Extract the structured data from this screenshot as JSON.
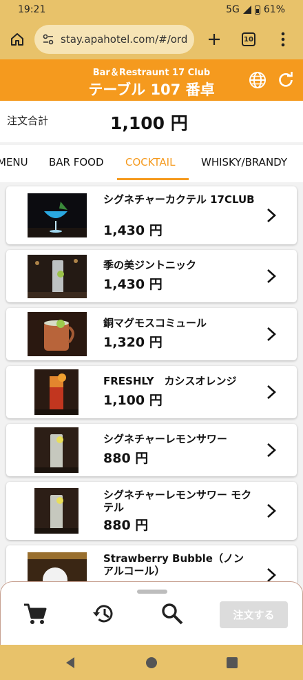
{
  "status": {
    "time": "19:21",
    "network": "5G",
    "battery": "61%"
  },
  "browser": {
    "url": "stay.apahotel.com/#/ord",
    "tab_count": "10"
  },
  "header": {
    "subtitle": "Bar＆Restraunt 17 Club",
    "title": "テーブル 107 番卓"
  },
  "total": {
    "label": "注文合計",
    "value": "1,100 円"
  },
  "tabs": [
    {
      "label": "MENU"
    },
    {
      "label": "BAR FOOD"
    },
    {
      "label": "COCKTAIL"
    },
    {
      "label": "WHISKY/BRANDY"
    }
  ],
  "active_tab": "COCKTAIL",
  "items": [
    {
      "name": "シグネチャーカクテル 17CLUB",
      "price": "1,430 円"
    },
    {
      "name": "季の美ジントニック",
      "price": "1,430 円"
    },
    {
      "name": "銅マグモスコミュール",
      "price": "1,320 円"
    },
    {
      "name": "FRESHLY　カシスオレンジ",
      "price": "1,100 円"
    },
    {
      "name": "シグネチャーレモンサワー",
      "price": "880 円"
    },
    {
      "name": "シグネチャーレモンサワー モクテル",
      "price": "880 円"
    },
    {
      "name": "Strawberry Bubble（ノンアルコール）",
      "price": ""
    }
  ],
  "bottom": {
    "order_button": "注文する"
  },
  "icons": {
    "home": "home-icon",
    "site_settings": "site-settings-icon",
    "new_tab": "plus-icon",
    "menu": "more-vert-icon",
    "language": "globe-icon",
    "refresh": "refresh-icon",
    "cart": "cart-icon",
    "history": "history-icon",
    "search": "search-icon"
  },
  "colors": {
    "accent": "#f59a1e",
    "chrome": "#e8c26a"
  }
}
